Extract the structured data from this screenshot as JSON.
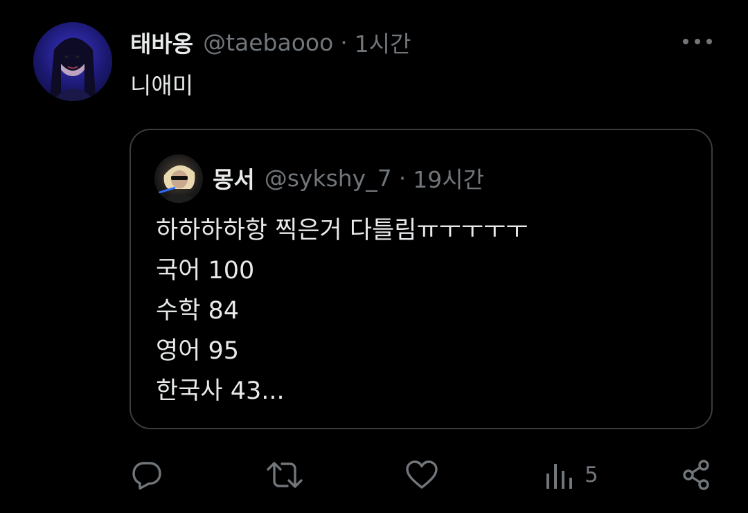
{
  "tweet": {
    "author": {
      "display_name": "태바옹",
      "handle": "@taebaooo",
      "separator": "·",
      "time": "1시간"
    },
    "text": "니애미"
  },
  "quoted_tweet": {
    "author": {
      "display_name": "몽서",
      "handle": "@sykshy_7",
      "separator": "·",
      "time": "19시간"
    },
    "lines": [
      "하하하하항 찍은거 다틀림ㅠㅜㅜㅜㅜ",
      "국어 100",
      "수학 84",
      "영어 95",
      "한국사 43..."
    ]
  },
  "actions": {
    "views_count": "5"
  },
  "icons": {
    "more": "more-horizontal-icon",
    "reply": "reply-icon",
    "retweet": "retweet-icon",
    "like": "heart-icon",
    "views": "views-bar-icon",
    "share": "share-icon"
  }
}
